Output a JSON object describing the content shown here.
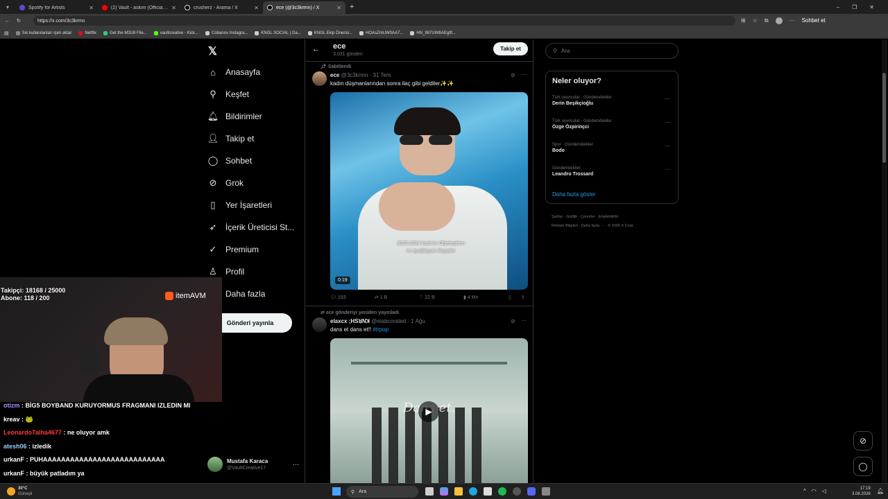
{
  "browser": {
    "tabs": [
      {
        "title": "Spotify for Artists",
        "color": "#5b4bdb",
        "active": false
      },
      {
        "title": "(2) Vault - askim (Official Music Vi...",
        "color": "#ff0000",
        "active": false
      },
      {
        "title": "crusherz - Arama / X",
        "color": "#000000",
        "active": false
      },
      {
        "title": "ece (@3c3krmn) / X",
        "color": "#000000",
        "active": true
      }
    ],
    "new_tab": "+",
    "url": "https://x.com/3c3krmn",
    "profile_label": "Sohbet et",
    "bookmarks": [
      {
        "label": "Sık kullanılanları içeri aktar",
        "color": "#888888"
      },
      {
        "label": "Netflix",
        "color": "#e50914"
      },
      {
        "label": "Get the M3U8 File...",
        "color": "#2ecc71"
      },
      {
        "label": "vaultcreative - Kick...",
        "color": "#53fc18"
      },
      {
        "label": "Cobanov Instagra...",
        "color": "#cccccc"
      },
      {
        "label": "KNGL SOCIAL | Ga...",
        "color": "#cccccc"
      },
      {
        "label": "KNGL Ekip Önerisi...",
        "color": "#cccccc"
      },
      {
        "label": "HOAsZmUW0AA7...",
        "color": "#cccccc"
      },
      {
        "label": "HN_987UW8AEgIfl...",
        "color": "#cccccc"
      }
    ]
  },
  "nav": {
    "items": [
      {
        "label": "Anasayfa",
        "icon": "home-icon",
        "glyph": "⌂"
      },
      {
        "label": "Keşfet",
        "icon": "search-icon",
        "glyph": "⚲"
      },
      {
        "label": "Bildirimler",
        "icon": "bell-icon",
        "glyph": "🔔︎"
      },
      {
        "label": "Takip et",
        "icon": "follow-icon",
        "glyph": "👤︎"
      },
      {
        "label": "Sohbet",
        "icon": "chat-icon",
        "glyph": "◯"
      },
      {
        "label": "Grok",
        "icon": "grok-icon",
        "glyph": "⊘"
      },
      {
        "label": "Yer İşaretleri",
        "icon": "bookmark-icon",
        "glyph": "▯"
      },
      {
        "label": "İçerik Üreticisi St...",
        "icon": "rocket-icon",
        "glyph": "➶"
      },
      {
        "label": "Premium",
        "icon": "verified-icon",
        "glyph": "✓"
      },
      {
        "label": "Profil",
        "icon": "profile-icon",
        "glyph": "♙"
      },
      {
        "label": "Daha fazla",
        "icon": "more-icon",
        "glyph": "⋯"
      }
    ],
    "post_button": "Gönderi yayınla",
    "account": {
      "name": "Mustafa Karaca",
      "handle": "@VaultCreative17"
    }
  },
  "profile_header": {
    "name": "ece",
    "posts": "3.031 gönderi",
    "follow": "Takip et"
  },
  "posts": [
    {
      "context": "Sabitlendi",
      "author": "ece",
      "handle": "@3c3krmn",
      "date": "· 31 Tem",
      "text": "kadın düşmanlarından sonra ilaç gibi geldiler✨✨",
      "video_caption": "2023-2024 kadının Objeleştiren ve aşağılayan Rapçiler",
      "duration": "0:19",
      "replies": "193",
      "reposts": "1 B",
      "likes": "22 B",
      "views": "4 Mn"
    },
    {
      "context": "ece gönderiyi yeniden yayınladı",
      "author": "elaxcx ;HSꓤNꓘ",
      "handle": "@elabcorated",
      "date": "· 1 Ağu",
      "text": "dans et dans et!!",
      "hashtag": "#trpop",
      "video_caption": "Dans et."
    }
  ],
  "sidebar": {
    "search_placeholder": "Ara",
    "trends_title": "Neler oluyor?",
    "trends": [
      {
        "category": "Türk oyuncular · Gündemdekiler",
        "name": "Derin Beşikçioğlu"
      },
      {
        "category": "Türk oyuncular · Gündemdekiler",
        "name": "Özge Özpirinçci"
      },
      {
        "category": "Spor · Gündemdekiler",
        "name": "Bodo"
      },
      {
        "category": "Gündemdekiler",
        "name": "Leandro Trossard"
      }
    ],
    "show_more": "Daha fazla göster",
    "footer_line1": "Şartlar  ·  Gizlilik  ·  Çerezler  ·  Erişilebilirlik",
    "footer_line2": "Reklam Bilgileri  ·  Daha fazla ···  ·  © 2026 X Corp."
  },
  "stream": {
    "followers": "Takipçi: 18168 / 25000",
    "subs": "Abone: 118 / 200",
    "sponsor": "itemAVM",
    "chat": [
      {
        "user": "otizm",
        "color": "#b18cff",
        "text": " : BİG5 BOYBAND KURUYORMUS FRAGMANI IZLEDIN MI"
      },
      {
        "user": "kreav",
        "color": "#ffffff",
        "text": " :  🐸"
      },
      {
        "user": "LeonardoTalha4677",
        "color": "#ff3b3b",
        "text": " : ne oluyor amk"
      },
      {
        "user": "atesh06",
        "color": "#9ad0ff",
        "text": " : izledik"
      },
      {
        "user": "urkanF",
        "color": "#ffffff",
        "text": " : PUHAAAAAAAAAAAAAAAAAAAAAAAAAAA"
      },
      {
        "user": "urkanF",
        "color": "#ffffff",
        "text": " : büyük patladım ya"
      }
    ]
  },
  "taskbar": {
    "weather_temp": "30°C",
    "weather_desc": "Güneşli",
    "search": "Ara",
    "time": "17:19",
    "date": "3.08.2026"
  }
}
